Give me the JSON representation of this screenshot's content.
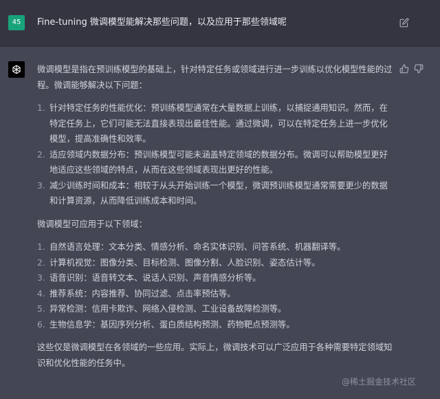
{
  "user": {
    "avatar_text": "45",
    "message": "Fine-tuning 微调模型能解决那些问题，以及应用于那些领域呢"
  },
  "assistant": {
    "intro": "微调模型是指在预训练模型的基础上，针对特定任务或领域进行进一步训练以优化模型性能的过程。微调能够解决以下问题：",
    "problems": [
      {
        "num": "1.",
        "text": "针对特定任务的性能优化：预训练模型通常在大量数据上训练，以捕捉通用知识。然而，在特定任务上，它们可能无法直接表现出最佳性能。通过微调，可以在特定任务上进一步优化模型，提高准确性和效率。"
      },
      {
        "num": "2.",
        "text": "适应领域内数据分布：预训练模型可能未涵盖特定领域的数据分布。微调可以帮助模型更好地适应这些领域的特点，从而在这些领域表现出更好的性能。"
      },
      {
        "num": "3.",
        "text": "减少训练时间和成本：相较于从头开始训练一个模型，微调预训练模型通常需要更少的数据和计算资源，从而降低训练成本和时间。"
      }
    ],
    "domains_intro": "微调模型可应用于以下领域：",
    "domains": [
      {
        "num": "1.",
        "text": "自然语言处理：文本分类、情感分析、命名实体识别、问答系统、机器翻译等。"
      },
      {
        "num": "2.",
        "text": "计算机视觉：图像分类、目标检测、图像分割、人脸识别、姿态估计等。"
      },
      {
        "num": "3.",
        "text": "语音识别：语音转文本、说话人识别、声音情感分析等。"
      },
      {
        "num": "4.",
        "text": "推荐系统：内容推荐、协同过滤、点击率预估等。"
      },
      {
        "num": "5.",
        "text": "异常检测：信用卡欺诈、网络入侵检测、工业设备故障检测等。"
      },
      {
        "num": "6.",
        "text": "生物信息学：基因序列分析、蛋白质结构预测、药物靶点预测等。"
      }
    ],
    "conclusion": "这些仅是微调模型在各领域的一些应用。实际上，微调技术可以广泛应用于各种需要特定领域知识和优化性能的任务中。"
  },
  "watermark": "@稀土掘金技术社区",
  "icons": {
    "edit": "pencil-edit-icon",
    "openai": "openai-logo-icon",
    "thumbs_up": "thumbs-up-icon",
    "thumbs_down": "thumbs-down-icon"
  },
  "colors": {
    "user_bg": "#343541",
    "assistant_bg": "#444654",
    "user_avatar": "#19a37b",
    "text": "#d1d5db"
  }
}
